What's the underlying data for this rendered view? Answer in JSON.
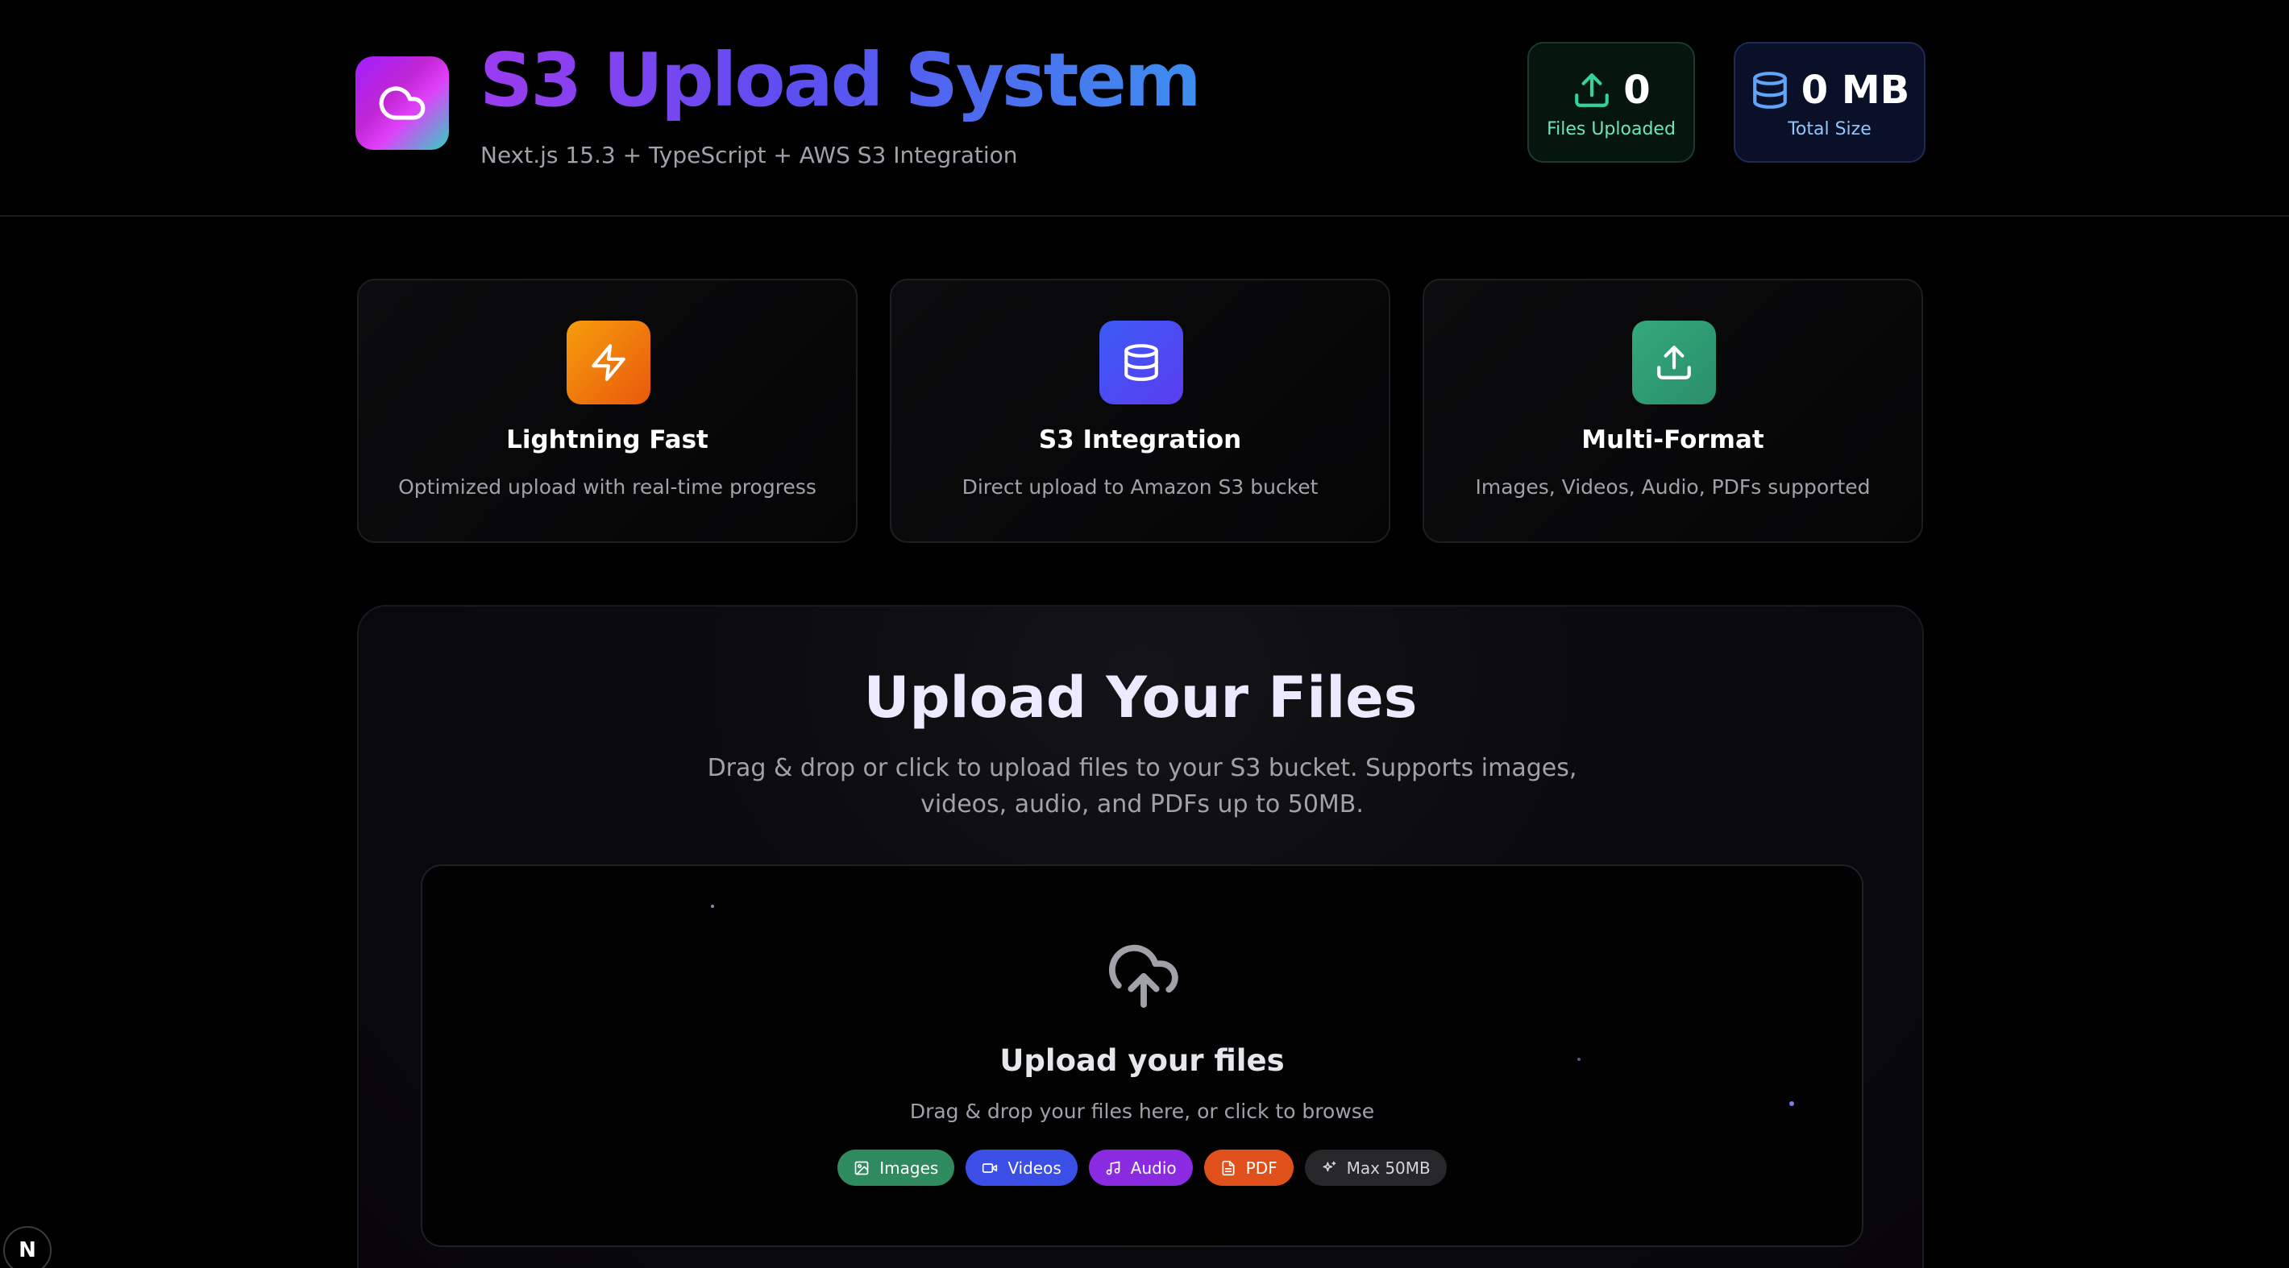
{
  "header": {
    "title": "S3 Upload System",
    "subtitle": "Next.js 15.3 + TypeScript + AWS S3 Integration",
    "logo_icon": "cloud-icon",
    "stats": {
      "files": {
        "value": "0",
        "label": "Files Uploaded",
        "icon": "upload-icon",
        "color": "#34d399"
      },
      "size": {
        "value": "0 MB",
        "label": "Total Size",
        "icon": "database-icon",
        "color": "#60a5fa"
      }
    }
  },
  "features": [
    {
      "title": "Lightning Fast",
      "description": "Optimized upload with real-time progress",
      "icon": "lightning-icon",
      "color": "#ea7a10"
    },
    {
      "title": "S3 Integration",
      "description": "Direct upload to Amazon S3 bucket",
      "icon": "database-icon",
      "color": "#4f46e5"
    },
    {
      "title": "Multi-Format",
      "description": "Images, Videos, Audio, PDFs supported",
      "icon": "upload-icon",
      "color": "#2f9a6e"
    }
  ],
  "upload": {
    "title": "Upload Your Files",
    "description": "Drag & drop or click to upload files to your S3 bucket. Supports images, videos, audio, and PDFs up to 50MB.",
    "dropzone": {
      "icon": "cloud-upload-icon",
      "title": "Upload your files",
      "description": "Drag & drop your files here, or click to browse",
      "chips": [
        {
          "label": "Images",
          "icon": "image-icon"
        },
        {
          "label": "Videos",
          "icon": "video-icon"
        },
        {
          "label": "Audio",
          "icon": "music-icon"
        },
        {
          "label": "PDF",
          "icon": "file-icon"
        },
        {
          "label": "Max 50MB",
          "icon": "sparkle-icon"
        }
      ]
    }
  },
  "devtools_badge": {
    "label": "N"
  }
}
